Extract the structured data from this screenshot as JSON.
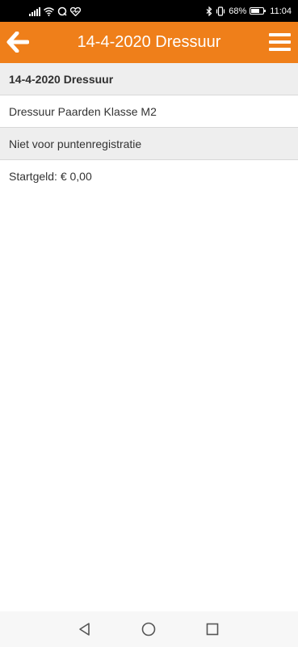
{
  "status_bar": {
    "battery_percent": "68%",
    "time": "11:04",
    "battery_level": 0.68,
    "left_icons": [
      "signal-icon",
      "wifi-icon",
      "sync-icon",
      "health-icon"
    ],
    "right_icons": [
      "bluetooth-icon",
      "vibrate-icon",
      "battery-icon"
    ]
  },
  "header": {
    "title": "14-4-2020 Dressuur",
    "background_color": "#ef7f1a",
    "back_icon": "arrow-left-icon",
    "menu_icon": "hamburger-menu-icon"
  },
  "details": {
    "heading": "14-4-2020 Dressuur",
    "class_name": "Dressuur Paarden Klasse M2",
    "registration_note": "Niet voor puntenregistratie",
    "entry_fee": "Startgeld: € 0,00"
  },
  "nav_bar": {
    "icons": [
      "back-triangle-icon",
      "home-circle-icon",
      "recents-square-icon"
    ]
  }
}
